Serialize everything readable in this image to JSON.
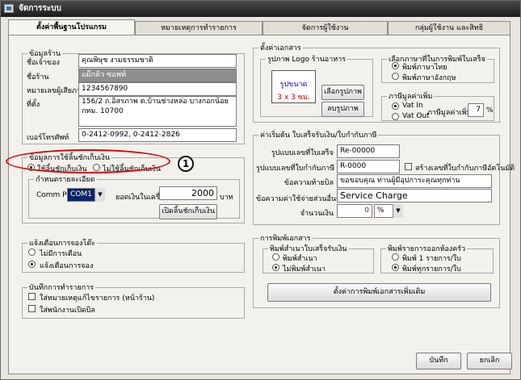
{
  "window": {
    "title": "จัดการระบบ"
  },
  "tabs": [
    "ตั้งค่าพื้นฐานโปรแกรม",
    "หมายเหตุการทำรายการ",
    "จัดการผู้ใช้งาน",
    "กลุ่มผู้ใช้งาน และสิทธิ"
  ],
  "shop": {
    "legend": "ข้อมูลร้าน",
    "owner_label": "ชื่อเจ้าของ",
    "owner_value": "คุณพิษุช งามธรรมชาติ",
    "name_label": "ชื่อร้าน",
    "name_value": "แม็กคิว ซอฟท์",
    "tax_label": "หมายเลขผู้เสียภาษี",
    "tax_value": "1234567890",
    "address_label": "ที่ตั้ง",
    "address_value": "156/2 ถ.อิสรภาพ ต.บ้านช่างหล่อ บางกอกน้อย กทม. 10700",
    "phone_label": "เบอร์โทรศัพท์",
    "phone_value": "0-2412-0992, 0-2412-2826"
  },
  "drawer": {
    "legend": "ข้อมูลการใช้ลิ้นชักเก็บเงิน",
    "use_label": "ใช้ลิ้นชักเก็บเงิน",
    "nouse_label": "ไม่ใช้ลิ้นชักเก็บเงิน",
    "detail_legend": "กำหนดรายละเอียด",
    "port_label": "Comm Port",
    "port_value": "COM1",
    "amount_label": "ยอดเงินในเครื่อง",
    "amount_value": "2000",
    "amount_unit": "บาท",
    "open_button": "เปิดลิ้นชักเก็บเงิน",
    "callout": "1"
  },
  "booking": {
    "legend": "แจ้งเตือนการจองโต๊ะ",
    "off_label": "ไม่มีการเตือน",
    "on_label": "แจ้งเตือนการจอง"
  },
  "record": {
    "legend": "บันทึกการทำรายการ",
    "item1": "ใส่หมายเหตุแก้ไขรายการ (หน้าร้าน)",
    "item2": "ใส่พนักงานเปิดบิล"
  },
  "doc": {
    "legend": "ตั้งค่าเอกสาร",
    "logo_legend": "รูปภาพ Logo ร้านอาหาร",
    "logo_line1": "รูปขนาด",
    "logo_line2": "3 x 3 ซม.",
    "choose_button": "เลือกรูปภาพ",
    "delete_button": "ลบรูปภาพ",
    "lang_legend": "เลือกภาษาที่ในการพิมพ์ใบเสร็จ",
    "lang_thai": "พิมพ์ภาษาไทย",
    "lang_eng": "พิมพ์ภาษาอังกฤษ",
    "vat_legend": "ภาษีมูลค่าเพิ่ม",
    "vat_in": "Vat In",
    "vat_out": "Vat Out",
    "vat_rate_label": "ภาษีมูลค่าเพิ่ม",
    "vat_rate_value": "7",
    "vat_unit": "%"
  },
  "receipt": {
    "legend": "ค่าเริ่มต้น ใบเสร็จรับเงิน/ใบกำกับภาษี",
    "receipt_label": "รูปแบบเลขที่ใบเสร็จ",
    "receipt_value": "Re-00000",
    "tax_label": "รูปแบบเลขที่ใบกำกับภาษี",
    "tax_value": "R-0000",
    "auto_label": "สร้างเลขที่ใบกำกับภาษีอัตโนมัติ",
    "footer_label": "ข้อความท้ายบิล",
    "footer_value": "ขอขอบคุณ ท่านผู้มีอุปการะคุณทุกท่าน",
    "service_label": "ข้อความค่าใช้จ่ายส่วนอื่นๆ",
    "service_value": "Service Charge",
    "amount_label": "จำนวนเงิน",
    "amount_value": "0",
    "amount_unit": "%"
  },
  "print": {
    "legend": "การพิมพ์เอกสาร",
    "copy_legend": "พิมพ์สำเนาใบเสร็จรับเงิน",
    "copy_yes": "พิมพ์สำเนา",
    "copy_no": "ไม่พิมพ์สำเนา",
    "kitchen_legend": "พิมพ์รายการออกห้องครัว",
    "kitchen_one": "พิมพ์ 1 รายการ/ใบ",
    "kitchen_all": "พิมพ์ทุกรายการ/ใบ",
    "more_button": "ตั้งค่าการพิมพ์เอกสารเพิ่มเติม"
  },
  "footer": {
    "save": "บันทึก",
    "cancel": "ยกเลิก"
  }
}
